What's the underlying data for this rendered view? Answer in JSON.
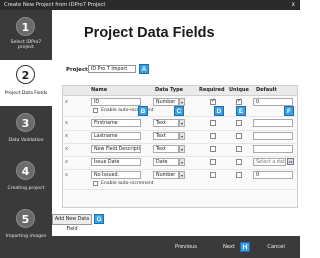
{
  "window": {
    "title": "Create New Project from IDPro7 Project",
    "close_glyph": "x"
  },
  "steps": [
    {
      "number": "1",
      "label_line1": "Select IDPro7",
      "label_line2": "project"
    },
    {
      "number": "2",
      "label_line1": "Project Data Fields",
      "label_line2": ""
    },
    {
      "number": "3",
      "label_line1": "Data Validation",
      "label_line2": ""
    },
    {
      "number": "4",
      "label_line1": "Creating project",
      "label_line2": ""
    },
    {
      "number": "5",
      "label_line1": "Importing images",
      "label_line2": ""
    }
  ],
  "main": {
    "title": "Project Data Fields",
    "project_name_label": "Project name",
    "project_name_value": "ID Pro 7 Import"
  },
  "badges": {
    "a": "A",
    "b": "B",
    "c": "C",
    "d": "D",
    "e": "E",
    "f": "F",
    "g": "G",
    "h": "H"
  },
  "table": {
    "headers": {
      "name": "Name",
      "data_type": "Data Type",
      "required": "Required",
      "unique": "Unique",
      "default": "Default"
    },
    "remove_glyph": "x",
    "arrow_glyph": "▾",
    "rows": [
      {
        "name": "ID",
        "type": "Number",
        "required": true,
        "unique": true,
        "default": "0",
        "auto_increment": "Enable auto-increment"
      },
      {
        "name": "Firstname",
        "type": "Text",
        "required": false,
        "unique": false,
        "default": ""
      },
      {
        "name": "Lastname",
        "type": "Text",
        "required": false,
        "unique": false,
        "default": ""
      },
      {
        "name": "New Field Description",
        "type": "Text",
        "required": false,
        "unique": false,
        "default": ""
      },
      {
        "name": "Issue Date",
        "type": "Date",
        "required": false,
        "unique": false,
        "default": "Select a date",
        "calendar_label": "15"
      },
      {
        "name": "No Issued.",
        "type": "Number",
        "required": false,
        "unique": false,
        "default": "0",
        "auto_increment": "Enable auto-increment"
      }
    ]
  },
  "add_field_label": "Add New Data Field",
  "footer": {
    "previous": "Previous",
    "next": "Next",
    "cancel": "Cancel"
  },
  "colors": {
    "accent": "#3aa0e6",
    "sidebar": "#3a3a3a"
  }
}
